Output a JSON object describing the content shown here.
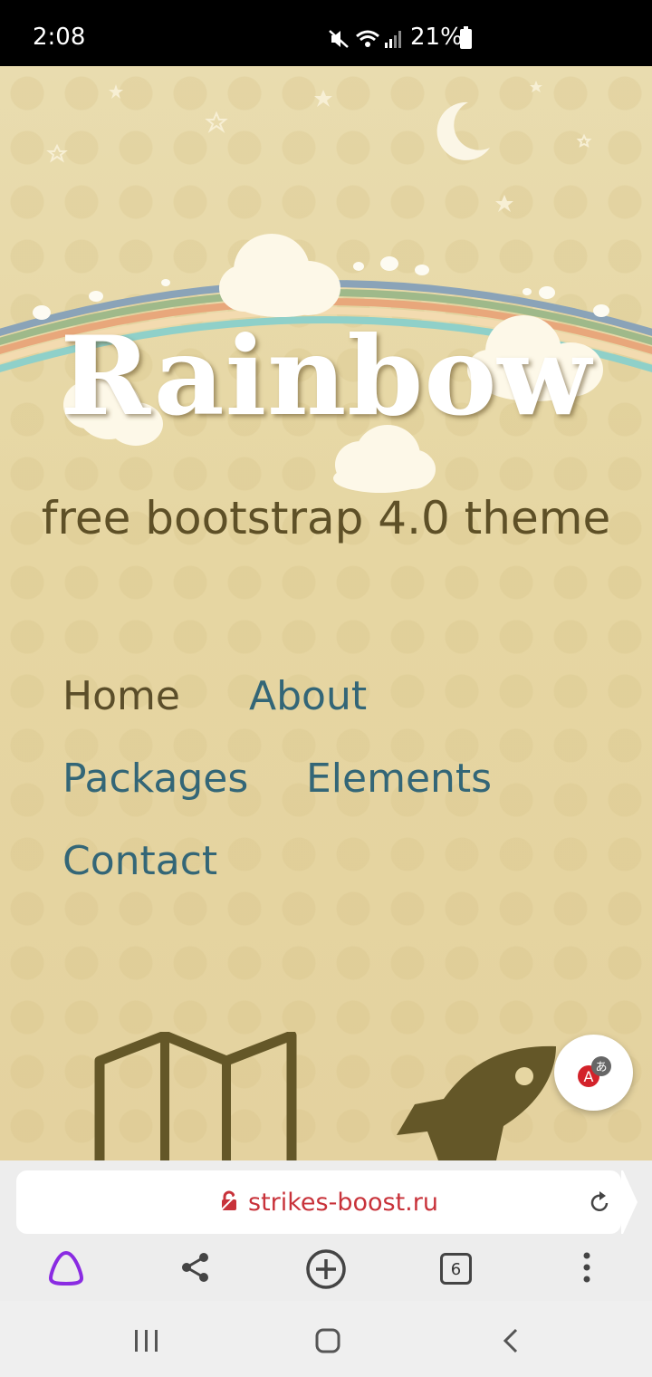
{
  "status_bar": {
    "time": "2:08",
    "battery_percent": "21%",
    "icons": [
      "mute-icon",
      "wifi-icon",
      "signal-icon",
      "battery-icon"
    ]
  },
  "hero": {
    "title": "Rainbow",
    "subtitle": "free bootstrap 4.0 theme"
  },
  "nav": {
    "items": [
      {
        "label": "Home",
        "active": true
      },
      {
        "label": "About",
        "active": false
      },
      {
        "label": "Packages",
        "active": false
      },
      {
        "label": "Elements",
        "active": false
      },
      {
        "label": "Contact",
        "active": false
      }
    ]
  },
  "features": {
    "icons": [
      "map-icon",
      "rocket-icon"
    ]
  },
  "browser": {
    "url": "strikes-boost.ru",
    "tabs_count": "6",
    "toolbar_icons": [
      "alice-icon",
      "share-icon",
      "new-tab-icon",
      "tabs-icon",
      "more-icon"
    ]
  },
  "colors": {
    "background": "#e8d9a8",
    "nav_link": "#336677",
    "nav_active": "#5b4e2a",
    "subtitle": "#5e5027",
    "url": "#c8323a",
    "icon_brown": "#645728"
  }
}
